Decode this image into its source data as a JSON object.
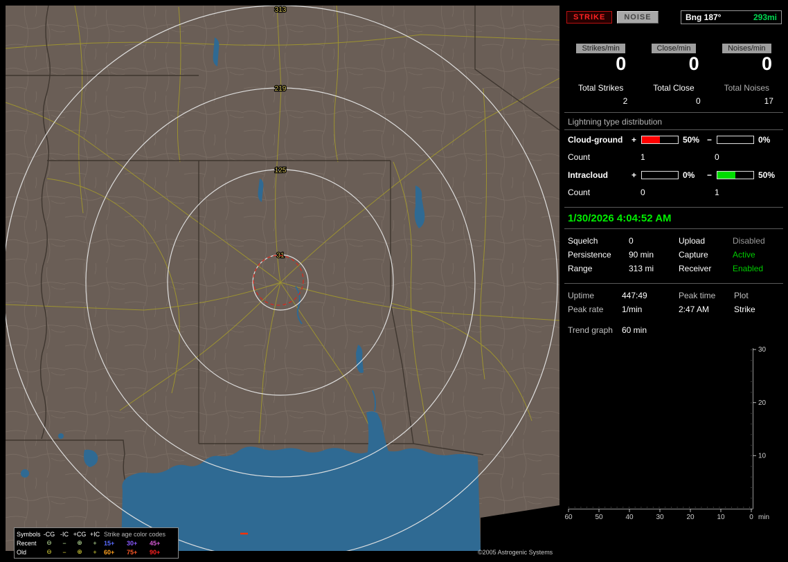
{
  "window": {
    "copyright": "©2005 Astrogenic Systems"
  },
  "map": {
    "range_labels": [
      "313",
      "219",
      "125",
      "31"
    ],
    "legend": {
      "symbols_header": "Symbols",
      "columns": [
        "-CG",
        "-IC",
        "+CG",
        "+IC"
      ],
      "age_header": "Strike age color codes",
      "recent": {
        "label": "Recent",
        "symbols": [
          "⊖",
          "−",
          "⊕",
          "+"
        ],
        "color": "#c6eea4",
        "ages": [
          {
            "text": "15+",
            "color": "#5a6cff"
          },
          {
            "text": "30+",
            "color": "#8a5aff"
          },
          {
            "text": "45+",
            "color": "#d45ad4"
          }
        ]
      },
      "old": {
        "label": "Old",
        "symbols": [
          "⊖",
          "−",
          "⊕",
          "+"
        ],
        "color": "#e4de3a",
        "ages": [
          {
            "text": "60+",
            "color": "#ffa01e"
          },
          {
            "text": "75+",
            "color": "#ff5a28"
          },
          {
            "text": "90+",
            "color": "#ff2020"
          }
        ]
      }
    }
  },
  "panel": {
    "strike_button": "STRIKE",
    "noise_button": "NOISE",
    "bearing": {
      "label": "Bng 187°",
      "range": "293mi"
    },
    "counters": [
      {
        "label": "Strikes/min",
        "value": "0",
        "total_label": "Total Strikes",
        "total_value": "2"
      },
      {
        "label": "Close/min",
        "value": "0",
        "total_label": "Total Close",
        "total_value": "0"
      },
      {
        "label": "Noises/min",
        "value": "0",
        "total_label": "Total Noises",
        "total_value": "17"
      }
    ],
    "distribution": {
      "title": "Lightning type distribution",
      "rows": [
        {
          "name": "Cloud-ground",
          "plus_sign": "+",
          "plus_fill": 50,
          "plus_pct": "50%",
          "minus_sign": "−",
          "minus_fill": 0,
          "minus_pct": "0%",
          "fill_color": "#ff0000",
          "count_label": "Count",
          "plus_count": "1",
          "minus_count": "0"
        },
        {
          "name": "Intracloud",
          "plus_sign": "+",
          "plus_fill": 0,
          "plus_pct": "0%",
          "minus_sign": "−",
          "minus_fill": 50,
          "minus_pct": "50%",
          "fill_color": "#00dd00",
          "count_label": "Count",
          "plus_count": "0",
          "minus_count": "1"
        }
      ]
    },
    "datetime": "1/30/2026 4:04:52 AM",
    "status": {
      "rows": [
        {
          "l1": "Squelch",
          "v1": "0",
          "l2": "Upload",
          "v2": "Disabled",
          "v2_color": "#9a9a9a"
        },
        {
          "l1": "Persistence",
          "v1": "90 min",
          "l2": "Capture",
          "v2": "Active",
          "v2_color": "#00cc00"
        },
        {
          "l1": "Range",
          "v1": "313 mi",
          "l2": "Receiver",
          "v2": "Enabled",
          "v2_color": "#00cc00"
        }
      ]
    },
    "stats": {
      "r1": {
        "l1": "Uptime",
        "v1": "447:49",
        "l2": "Peak time",
        "l3": "Plot"
      },
      "r2": {
        "l1": "Peak rate",
        "v1": "1/min",
        "v2": "2:47 AM",
        "v3": "Strike"
      }
    },
    "trend": {
      "label": "Trend graph",
      "window": "60 min",
      "x_ticks": [
        "60",
        "50",
        "40",
        "30",
        "20",
        "10",
        "0"
      ],
      "x_unit": "min",
      "y_ticks": [
        "30",
        "20",
        "10"
      ],
      "y_max": 30
    }
  }
}
